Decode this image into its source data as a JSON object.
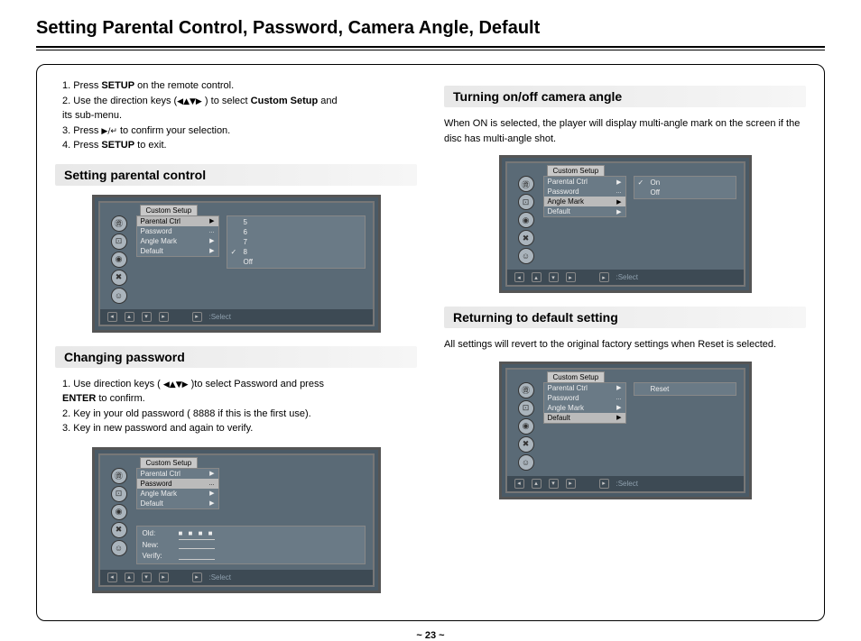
{
  "title": "Setting Parental Control, Password, Camera Angle, Default",
  "steps": {
    "s1a": "1. Press ",
    "s1b": "SETUP",
    "s1c": " on the remote control.",
    "s2a": "2. Use the direction keys (",
    "s2b": " ) to select ",
    "s2c": "Custom Setup",
    "s2d": " and",
    "s2e": "    its sub-menu.",
    "s3a": "3. Press ",
    "s3b": " to confirm your selection.",
    "s4a": "4. Press ",
    "s4b": "SETUP",
    "s4c": " to exit."
  },
  "sec1": "Setting parental control",
  "sec2": "Changing password",
  "sec2steps": {
    "a": "1. Use direction keys ( ",
    "a2": " )to select Password and press",
    "b": "    ENTER",
    "b2": " to confirm.",
    "c": "2. Key in your old password ( 8888 if this is the first use).",
    "d": "3. Key in new password and again to verify."
  },
  "sec3": "Turning on/off camera angle",
  "sec3text": "When ON is selected, the player will display multi-angle mark on the screen if the disc has multi-angle shot.",
  "sec4": "Returning to default setting",
  "sec4text": "All settings will revert to the original factory settings when Reset is selected.",
  "osd": {
    "tab": "Custom Setup",
    "menu": {
      "p": "Parental Ctrl",
      "pw": "Password",
      "am": "Angle Mark",
      "df": "Default",
      "dots": "..."
    },
    "pc_values": [
      "5",
      "6",
      "7",
      "8",
      "Off"
    ],
    "angle_values": [
      "On",
      "Off"
    ],
    "default_value": "Reset",
    "pw_labels": {
      "old": "Old:",
      "new": "New:",
      "ver": "Verify:"
    },
    "pw_dots": "■ ■ ■ ■",
    "footer": ":Select"
  },
  "arrows4": "◀▲▼▶",
  "arrow_enter": "▶/↵",
  "page": "~ 23 ~"
}
